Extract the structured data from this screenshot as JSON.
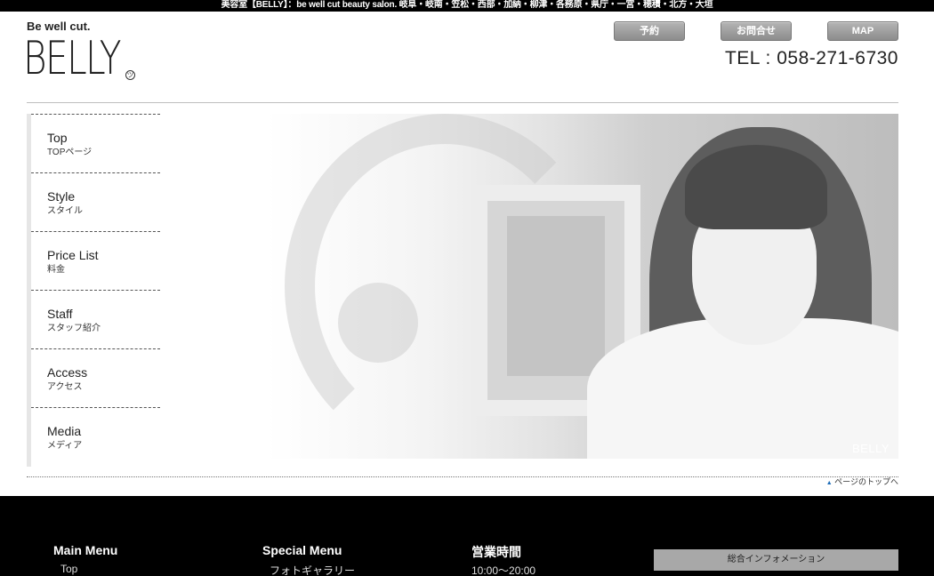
{
  "topbar": {
    "text": "美容室【BELLY】：be well cut beauty salon. 岐阜・岐南・笠松・西部・加納・柳津・各務原・県庁・一宮・穂積・北方・大垣"
  },
  "header": {
    "tagline": "Be well cut.",
    "logo": "BELLY",
    "logo_mark": "ツ",
    "buttons": [
      "予約",
      "お問合せ",
      "MAP"
    ],
    "tel": "TEL : 058-271-6730"
  },
  "sidebar": {
    "items": [
      {
        "en": "Top",
        "ja": "TOPページ"
      },
      {
        "en": "Style",
        "ja": "スタイル"
      },
      {
        "en": "Price List",
        "ja": "料金"
      },
      {
        "en": "Staff",
        "ja": "スタッフ紹介"
      },
      {
        "en": "Access",
        "ja": "アクセス"
      },
      {
        "en": "Media",
        "ja": "メディア"
      }
    ]
  },
  "hero": {
    "signature": "BELLY"
  },
  "pagetop": {
    "label": "ページのトップへ",
    "icon": "triangle-up-icon"
  },
  "footer": {
    "main_menu": {
      "title": "Main Menu",
      "first_item": "Top"
    },
    "special_menu": {
      "title": "Special Menu",
      "first_item": "フォトギャラリー"
    },
    "hours": {
      "title": "営業時間",
      "value": "10:00〜20:00"
    },
    "info": {
      "label": "総合インフォメーション"
    }
  }
}
